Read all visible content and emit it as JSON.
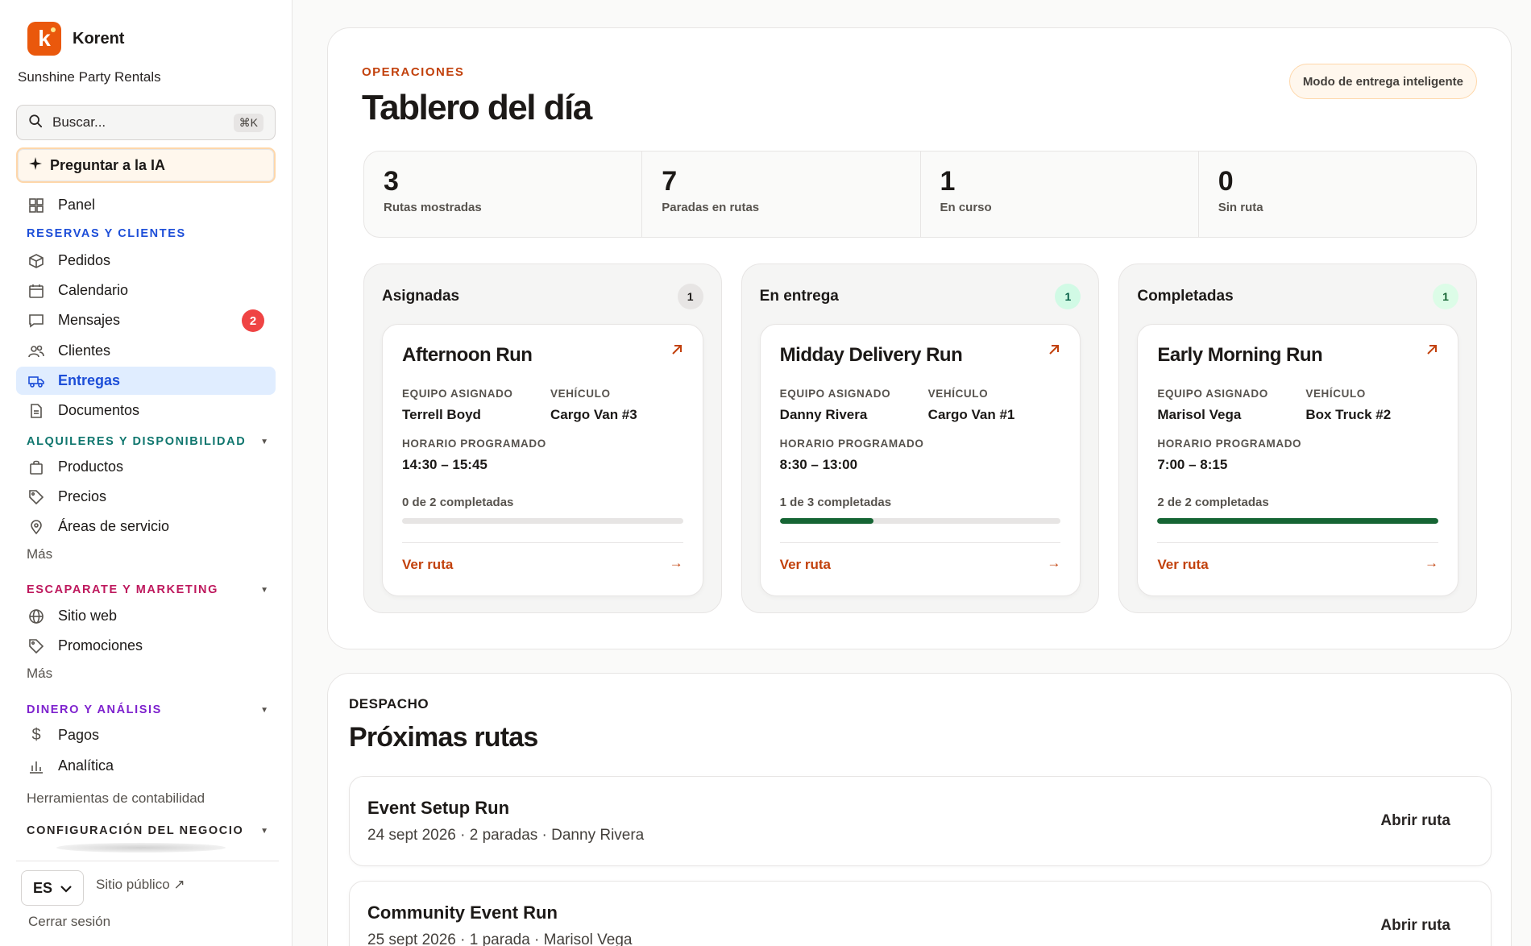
{
  "brand": {
    "logo_letter": "k",
    "name": "Korent",
    "org": "Sunshine Party Rentals"
  },
  "search": {
    "placeholder": "Buscar...",
    "shortcut": "⌘K"
  },
  "ask_ai": {
    "label": "Preguntar a la IA"
  },
  "nav": {
    "panel": "Panel",
    "section1": "RESERVAS Y CLIENTES",
    "pedidos": "Pedidos",
    "calendario": "Calendario",
    "mensajes": "Mensajes",
    "mensajes_badge": "2",
    "clientes": "Clientes",
    "entregas": "Entregas",
    "documentos": "Documentos",
    "section2": "ALQUILERES Y DISPONIBILIDAD",
    "productos": "Productos",
    "precios": "Precios",
    "areas": "Áreas de servicio",
    "mas1": "Más",
    "section3": "ESCAPARATE Y MARKETING",
    "sitio": "Sitio web",
    "promociones": "Promociones",
    "mas2": "Más",
    "section4": "DINERO Y ANÁLISIS",
    "pagos": "Pagos",
    "analitica": "Analítica",
    "herramientas": "Herramientas de contabilidad",
    "section5": "CONFIGURACIÓN DEL NEGOCIO"
  },
  "footer": {
    "lang": "ES",
    "public_site": "Sitio público ↗",
    "logout": "Cerrar sesión"
  },
  "colors": {
    "section1": "#1d4ed8",
    "section2": "#0f766e",
    "section3": "#be185d",
    "section4": "#7e22ce",
    "section5": "#292524",
    "accent": "#c2410c"
  },
  "header": {
    "eyebrow": "OPERACIONES",
    "title": "Tablero del día",
    "smart_mode": "Modo de entrega inteligente"
  },
  "stats": [
    {
      "value": "3",
      "label": "Rutas mostradas"
    },
    {
      "value": "7",
      "label": "Paradas en rutas"
    },
    {
      "value": "1",
      "label": "En curso"
    },
    {
      "value": "0",
      "label": "Sin ruta"
    }
  ],
  "field_labels": {
    "team": "EQUIPO ASIGNADO",
    "vehicle": "VEHÍCULO",
    "schedule": "HORARIO PROGRAMADO",
    "view_route": "Ver ruta"
  },
  "columns": [
    {
      "title": "Asignadas",
      "count": "1",
      "card": {
        "name": "Afternoon Run",
        "team": "Terrell Boyd",
        "vehicle": "Cargo Van #3",
        "schedule": "14:30 – 15:45",
        "progress_text": "0 de 2 completadas",
        "progress": 0
      }
    },
    {
      "title": "En entrega",
      "count": "1",
      "card": {
        "name": "Midday Delivery Run",
        "team": "Danny Rivera",
        "vehicle": "Cargo Van #1",
        "schedule": "8:30 – 13:00",
        "progress_text": "1 de 3 completadas",
        "progress": 0.333
      }
    },
    {
      "title": "Completadas",
      "count": "1",
      "card": {
        "name": "Early Morning Run",
        "team": "Marisol Vega",
        "vehicle": "Box Truck #2",
        "schedule": "7:00 – 8:15",
        "progress_text": "2 de 2 completadas",
        "progress": 1
      }
    }
  ],
  "dispatch": {
    "eyebrow": "DESPACHO",
    "title": "Próximas rutas",
    "routes": [
      {
        "name": "Event Setup Run",
        "meta": "24 sept 2026 · 2 paradas · Danny Rivera",
        "action": "Abrir ruta"
      },
      {
        "name": "Community Event Run",
        "meta": "25 sept 2026 · 1 parada · Marisol Vega",
        "action": "Abrir ruta"
      }
    ]
  }
}
